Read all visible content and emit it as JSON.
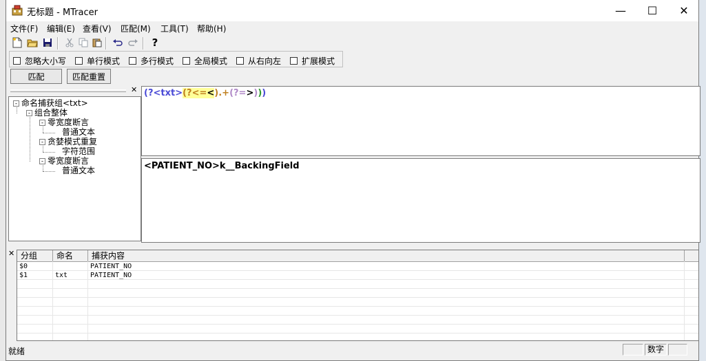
{
  "window": {
    "title": "无标题 - MTracer",
    "minimize": "—",
    "maximize": "☐",
    "close": "✕"
  },
  "menu": [
    "文件(F)",
    "编辑(E)",
    "查看(V)",
    "匹配(M)",
    "工具(T)",
    "帮助(H)"
  ],
  "toolbar": {
    "icons": [
      "new-file-icon",
      "open-folder-icon",
      "save-icon",
      "cut-icon",
      "copy-icon",
      "paste-icon",
      "undo-icon",
      "redo-icon",
      "help-icon"
    ],
    "help_glyph": "?"
  },
  "options": [
    "忽略大小写",
    "单行模式",
    "多行模式",
    "全局模式",
    "从右向左",
    "扩展模式"
  ],
  "buttons": {
    "match": "匹配",
    "match_reset": "匹配重置"
  },
  "tree": [
    {
      "label": "命名捕获组<txt>",
      "toggle": "-"
    },
    {
      "label": "组合整体",
      "toggle": "-"
    },
    {
      "label": "零宽度断言",
      "toggle": "-"
    },
    {
      "label": "普通文本",
      "toggle": ""
    },
    {
      "label": "贪婪模式重复",
      "toggle": "-"
    },
    {
      "label": "字符范围",
      "toggle": ""
    },
    {
      "label": "零宽度断言",
      "toggle": "-"
    },
    {
      "label": "普通文本",
      "toggle": ""
    }
  ],
  "regex": {
    "p1": "(?<txt>",
    "p2": "(?<=",
    "p3": "<",
    "p4": ")",
    "p5": ".+",
    "p6": "(?=",
    "p7": ">",
    "p8": ")",
    "p9": ")",
    "p10": ")"
  },
  "input_text": "<PATIENT_NO>k__BackingField",
  "results": {
    "headers": [
      "分组",
      "命名",
      "捕获内容"
    ],
    "rows": [
      [
        "$0",
        "",
        "PATIENT_NO"
      ],
      [
        "$1",
        "txt",
        "PATIENT_NO"
      ]
    ]
  },
  "status": {
    "text": "就绪",
    "mode": "数字"
  },
  "colors": {
    "regex_group": "#4b4bd6",
    "regex_highlight": "#ffff99",
    "regex_paren_green": "#2e9a2e"
  }
}
